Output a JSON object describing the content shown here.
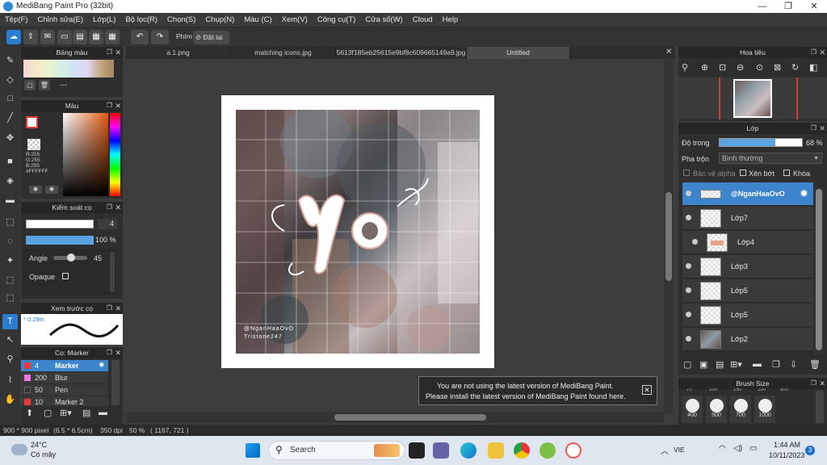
{
  "window": {
    "title": "MediBang Paint Pro (32bit)",
    "controls": [
      "—",
      "❐",
      "✕"
    ]
  },
  "menu": [
    "Tệp(F)",
    "Chỉnh sửa(E)",
    "Lớp(L)",
    "Bộ lọc(R)",
    "Chọn(S)",
    "Chụp(N)",
    "Màu (C)",
    "Xem(V)",
    "Công cụ(T)",
    "Cửa sổ(W)",
    "Cloud",
    "Help"
  ],
  "toolbar": {
    "phim_label": "Phím",
    "reset_label": "Đặt lại"
  },
  "tabs": [
    {
      "label": "a.1.png",
      "active": false
    },
    {
      "label": "matching icons.jpg",
      "active": false
    },
    {
      "label": "5613f185eb25615e9bf8c609665149a9.jpg",
      "active": false
    },
    {
      "label": "Untitled",
      "active": true
    }
  ],
  "panels": {
    "palette": {
      "title": "Bảng màu",
      "ellipsis": "---"
    },
    "color": {
      "title": "Màu",
      "r": "R:255",
      "g": "G:255",
      "b": "B:255",
      "hex": "#FFFFFF"
    },
    "brush_control": {
      "title": "Kiểm soát cọ",
      "size_value": "4",
      "opacity_value": "100 %",
      "angle_label": "Angle",
      "angle_value": "45",
      "opaque_label": "Opaque"
    },
    "brush_preview": {
      "title": "Xem trước cọ",
      "size_text": "0.29m"
    },
    "brush_list": {
      "title": "Cọ: Marker",
      "items": [
        {
          "size": "4",
          "name": "Marker",
          "color": "#e53b3b",
          "selected": true
        },
        {
          "size": "200",
          "name": "Blur",
          "color": "#e97ae0",
          "selected": false
        },
        {
          "size": "50",
          "name": "Pen",
          "color": "#333333",
          "selected": false
        },
        {
          "size": "10",
          "name": "Marker 2",
          "color": "#e53b3b",
          "selected": false
        }
      ]
    },
    "navigator": {
      "title": "Hoa tiêu"
    },
    "layers": {
      "title": "Lớp",
      "opacity_label": "Độ trong",
      "opacity_value": "68 %",
      "opacity_fraction": 0.68,
      "blend_label": "Pha trộn",
      "blend_value": "Bình thường",
      "protect_alpha": "Bảo vệ alpha",
      "clip_label": "Xén bớt",
      "lock_label": "Khóa",
      "items": [
        {
          "name": "@NganHaaOvO",
          "selected": true
        },
        {
          "name": "Lớp7",
          "selected": false
        },
        {
          "name": "Lớp4",
          "selected": false
        },
        {
          "name": "Lớp3",
          "selected": false
        },
        {
          "name": "Lớp5",
          "selected": false
        },
        {
          "name": "Lớp5",
          "selected": false
        },
        {
          "name": "Lớp2",
          "selected": false
        }
      ]
    },
    "brush_size": {
      "title": "Brush Size",
      "top_values": [
        "70",
        "100",
        "150",
        "200",
        "300"
      ],
      "values": [
        "400",
        "500",
        "700",
        "1000"
      ]
    }
  },
  "canvas": {
    "watermark_line1": "@NganHaaOvO",
    "watermark_line2": "Tristone247"
  },
  "notification": {
    "line1": "You are not using the latest version of MediBang Paint.",
    "line2": "Please install the latest version of MediBang Paint found here."
  },
  "status": {
    "dims": "900 * 900 pixel",
    "cm": "(6.5 * 6.5cm)",
    "dpi": "350 dpi",
    "zoom": "50 %",
    "coords": "( 1167, 721 )"
  },
  "taskbar": {
    "temp": "24°C",
    "weather": "Có mây",
    "search_placeholder": "Search",
    "lang": "VIE",
    "time": "1:44 AM",
    "date": "10/11/2023",
    "badge": "3"
  }
}
